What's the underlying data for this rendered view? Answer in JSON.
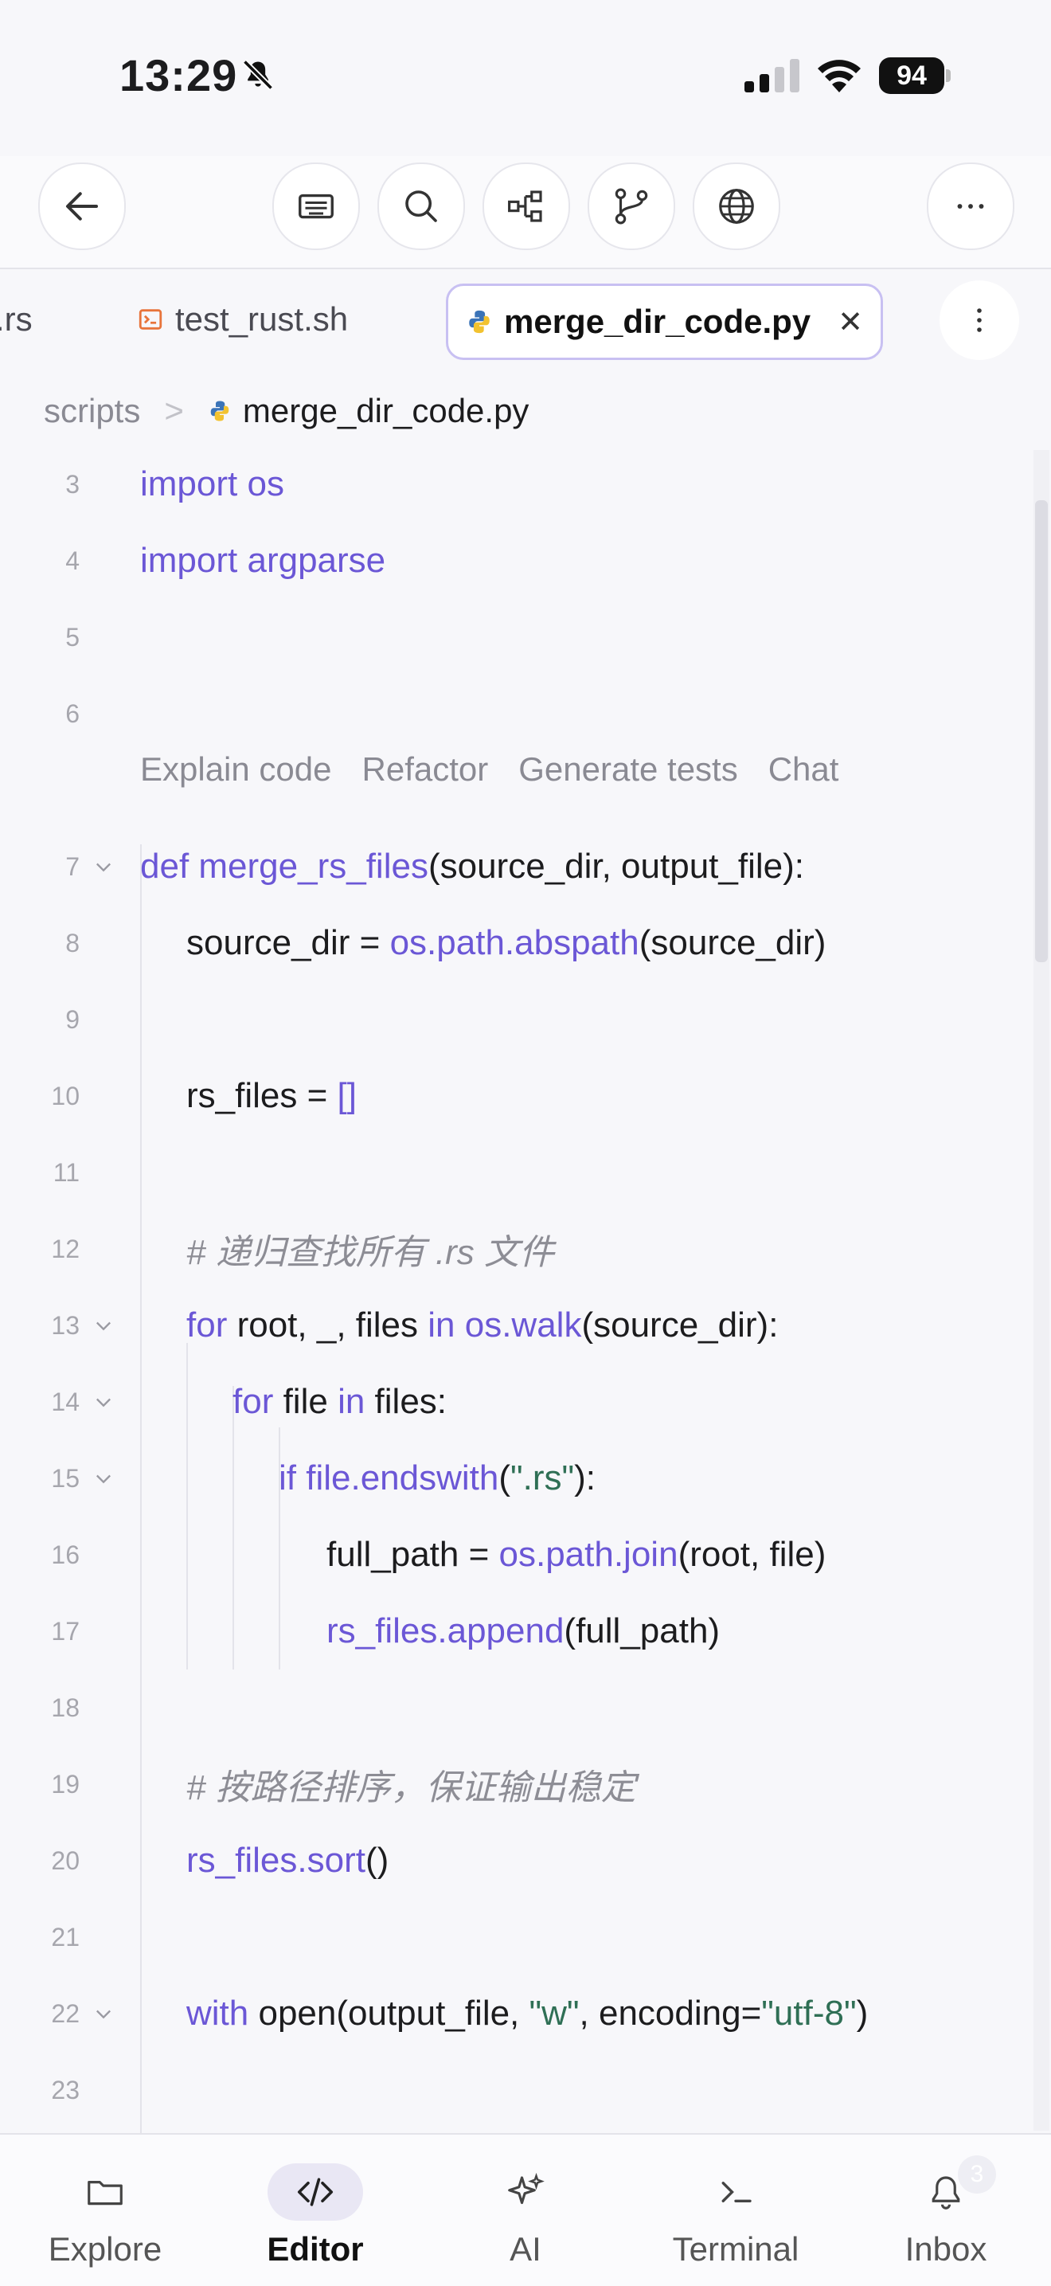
{
  "status": {
    "time": "13:29",
    "battery": "94"
  },
  "tabs": {
    "partial": ".rs",
    "items": [
      {
        "label": "test_rust.sh"
      },
      {
        "label": "merge_dir_code.py"
      }
    ]
  },
  "breadcrumb": {
    "folder": "scripts",
    "file": "merge_dir_code.py"
  },
  "codelens": {
    "explain": "Explain code",
    "refactor": "Refactor",
    "tests": "Generate tests",
    "chat": "Chat"
  },
  "code": {
    "l3": {
      "num": "3",
      "kw": "import",
      "rest": " os"
    },
    "l4": {
      "num": "4",
      "kw": "import",
      "rest": " argparse"
    },
    "l5": {
      "num": "5"
    },
    "l6": {
      "num": "6"
    },
    "l7": {
      "num": "7",
      "kw": "def",
      "fn": " merge_rs_files",
      "rest": "(source_dir, output_file):"
    },
    "l8": {
      "num": "8",
      "a": "source_dir = ",
      "fn": "os.path.abspath",
      "b": "(source_dir)"
    },
    "l9": {
      "num": "9"
    },
    "l10": {
      "num": "10",
      "a": "rs_files = ",
      "br": "[]"
    },
    "l11": {
      "num": "11"
    },
    "l12": {
      "num": "12",
      "cm": "# 递归查找所有 .rs 文件"
    },
    "l13": {
      "num": "13",
      "kw1": "for",
      "a": " root, _, files ",
      "kw2": "in",
      "fn": " os.walk",
      "b": "(source_dir):"
    },
    "l14": {
      "num": "14",
      "kw1": "for",
      "a": " file ",
      "kw2": "in",
      "b": " files:"
    },
    "l15": {
      "num": "15",
      "kw": "if",
      "fn": " file.endswith",
      "a": "(",
      "str": "\".rs\"",
      "b": "):"
    },
    "l16": {
      "num": "16",
      "a": "full_path = ",
      "fn": "os.path.join",
      "b": "(root, file)"
    },
    "l17": {
      "num": "17",
      "fn": "rs_files.append",
      "b": "(full_path)"
    },
    "l18": {
      "num": "18"
    },
    "l19": {
      "num": "19",
      "cm": "# 按路径排序，保证输出稳定"
    },
    "l20": {
      "num": "20",
      "fn": "rs_files.sort",
      "b": "()"
    },
    "l21": {
      "num": "21"
    },
    "l22": {
      "num": "22",
      "kw": "with",
      "a": " open(output_file, ",
      "s1": "\"w\"",
      "b": ", encoding=",
      "s2": "\"utf-8\"",
      "c": ")"
    },
    "l23": {
      "num": "23"
    }
  },
  "nav": {
    "items": [
      {
        "label": "Explore"
      },
      {
        "label": "Editor"
      },
      {
        "label": "AI"
      },
      {
        "label": "Terminal"
      },
      {
        "label": "Inbox"
      }
    ],
    "inbox_badge": "3"
  },
  "colors": {
    "accent": "#6b57d6",
    "string": "#2f6f55",
    "comment": "#8d8d95"
  }
}
